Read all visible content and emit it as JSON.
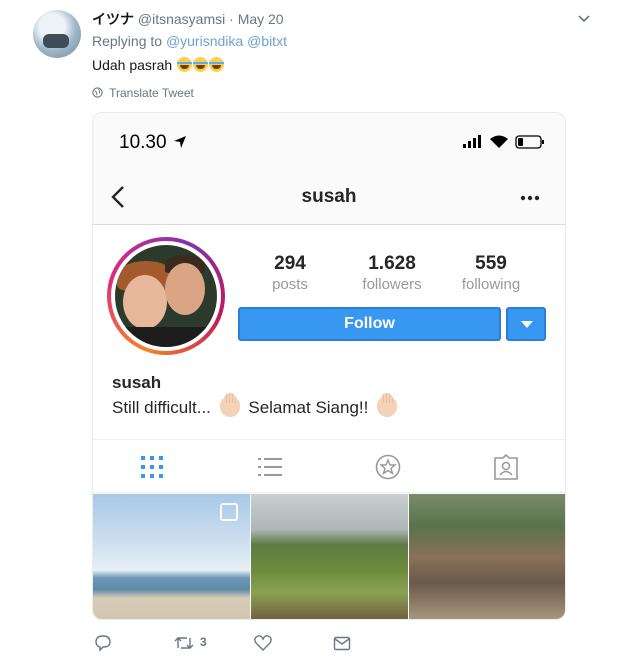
{
  "tweet": {
    "display_name": "イツナ",
    "handle": "@itsnasyamsi",
    "separator": "·",
    "date": "May 20",
    "replying_prefix": "Replying to",
    "reply_handles": [
      "@yurisndika",
      "@bitxt"
    ],
    "text": "Udah pasrah",
    "emojis": [
      "face-with-tears-of-joy",
      "face-with-tears-of-joy",
      "face-with-tears-of-joy"
    ],
    "translate_label": "Translate Tweet",
    "retweet_count": "3"
  },
  "phone": {
    "time": "10.30",
    "icons": [
      "location-arrow",
      "cellular-signal",
      "wifi",
      "battery"
    ]
  },
  "instagram": {
    "username_title": "susah",
    "stats": [
      {
        "num": "294",
        "label": "posts"
      },
      {
        "num": "1.628",
        "label": "followers"
      },
      {
        "num": "559",
        "label": "following"
      }
    ],
    "follow_label": "Follow",
    "bio_name": "susah",
    "bio_text_1": "Still difficult...",
    "bio_text_2": "Selamat Siang!!",
    "tabs": [
      "grid",
      "list",
      "star",
      "tagged"
    ],
    "active_tab_color": "#3897f0",
    "accent_color": "#3897f0"
  }
}
